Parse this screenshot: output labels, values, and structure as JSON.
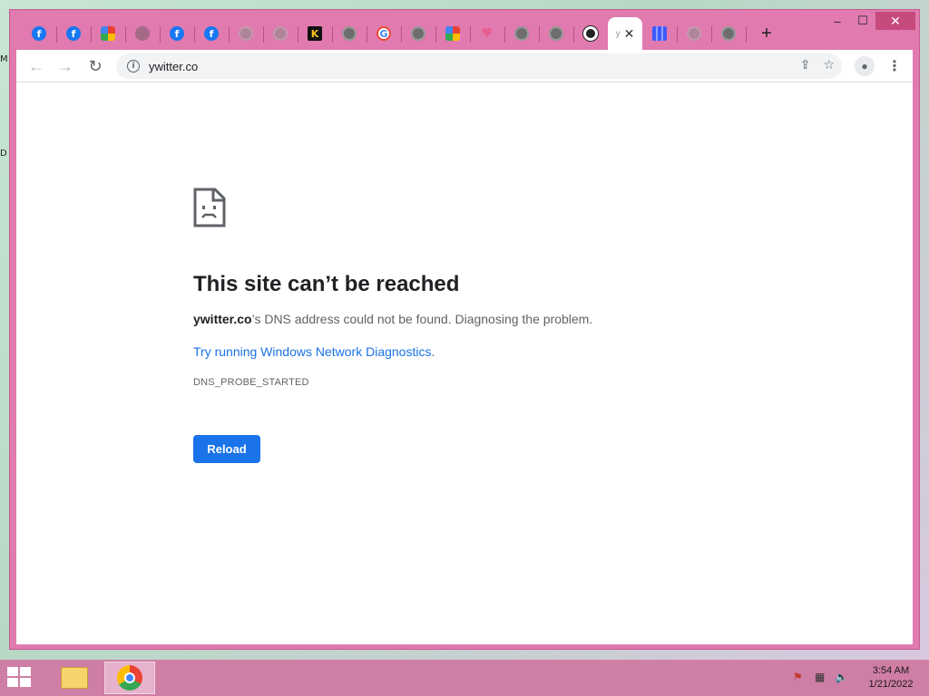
{
  "browser": {
    "tabs": [
      {
        "icon": "facebook-icon",
        "glyph": "f",
        "cls": "fav-fb"
      },
      {
        "icon": "facebook-icon",
        "glyph": "f",
        "cls": "fav-fb"
      },
      {
        "icon": "colorful-square-icon",
        "glyph": "",
        "cls": "fav-multi"
      },
      {
        "icon": "faded-site-icon",
        "glyph": "",
        "cls": "fav-dark"
      },
      {
        "icon": "facebook-icon",
        "glyph": "f",
        "cls": "fav-fb"
      },
      {
        "icon": "facebook-icon",
        "glyph": "f",
        "cls": "fav-fb"
      },
      {
        "icon": "globe-icon",
        "glyph": "",
        "cls": "fav-globe-faded"
      },
      {
        "icon": "globe-icon",
        "glyph": "",
        "cls": "fav-globe-faded"
      },
      {
        "icon": "k-logo-icon",
        "glyph": "K",
        "cls": "fav-k"
      },
      {
        "icon": "globe-icon",
        "glyph": "",
        "cls": "fav-globe"
      },
      {
        "icon": "google-icon",
        "glyph": "G",
        "cls": "fav-g"
      },
      {
        "icon": "globe-icon",
        "glyph": "",
        "cls": "fav-globe"
      },
      {
        "icon": "colorful-logo-icon",
        "glyph": "",
        "cls": "fav-multi"
      },
      {
        "icon": "heart-icon",
        "glyph": "♥",
        "cls": "fav-heart"
      },
      {
        "icon": "globe-icon",
        "glyph": "",
        "cls": "fav-globe"
      },
      {
        "icon": "globe-icon",
        "glyph": "",
        "cls": "fav-globe"
      },
      {
        "icon": "swirl-logo-icon",
        "glyph": "",
        "cls": "fav-swirl"
      }
    ],
    "active_tab": {
      "title": "y",
      "close": "✕"
    },
    "tabs_after": [
      {
        "icon": "grid-icon",
        "glyph": "",
        "cls": "fav-grid"
      },
      {
        "icon": "globe-icon",
        "glyph": "",
        "cls": "fav-globe-faded"
      },
      {
        "icon": "globe-icon",
        "glyph": "",
        "cls": "fav-globe"
      }
    ],
    "new_tab": "+",
    "window_controls": {
      "minimize": "–",
      "maximize": "☐",
      "close": "✕"
    },
    "nav": {
      "back": "←",
      "forward": "→",
      "reload": "↻"
    },
    "url": "ywitter.co",
    "info_glyph": "i",
    "share_glyph": "⇪",
    "star_glyph": "☆",
    "profile_glyph": "●",
    "menu_glyph": "⋮"
  },
  "error_page": {
    "title": "This site can’t be reached",
    "domain": "ywitter.co",
    "description": "’s DNS address could not be found. Diagnosing the problem.",
    "link_text": "Try running Windows Network Diagnostics",
    "link_suffix": ".",
    "error_code": "DNS_PROBE_STARTED",
    "reload_label": "Reload"
  },
  "desktop": {
    "edge_label_1": "M",
    "edge_label_2": "D"
  },
  "taskbar": {
    "time": "3:54 AM",
    "date": "1/21/2022",
    "tray_flag": "⚑",
    "tray_network": "▦",
    "tray_volume": "🔈"
  },
  "colors": {
    "window_frame": "#e17aae",
    "taskbar": "#cf7ea6",
    "reload_button": "#1a73e8",
    "link": "#1a73e8"
  }
}
